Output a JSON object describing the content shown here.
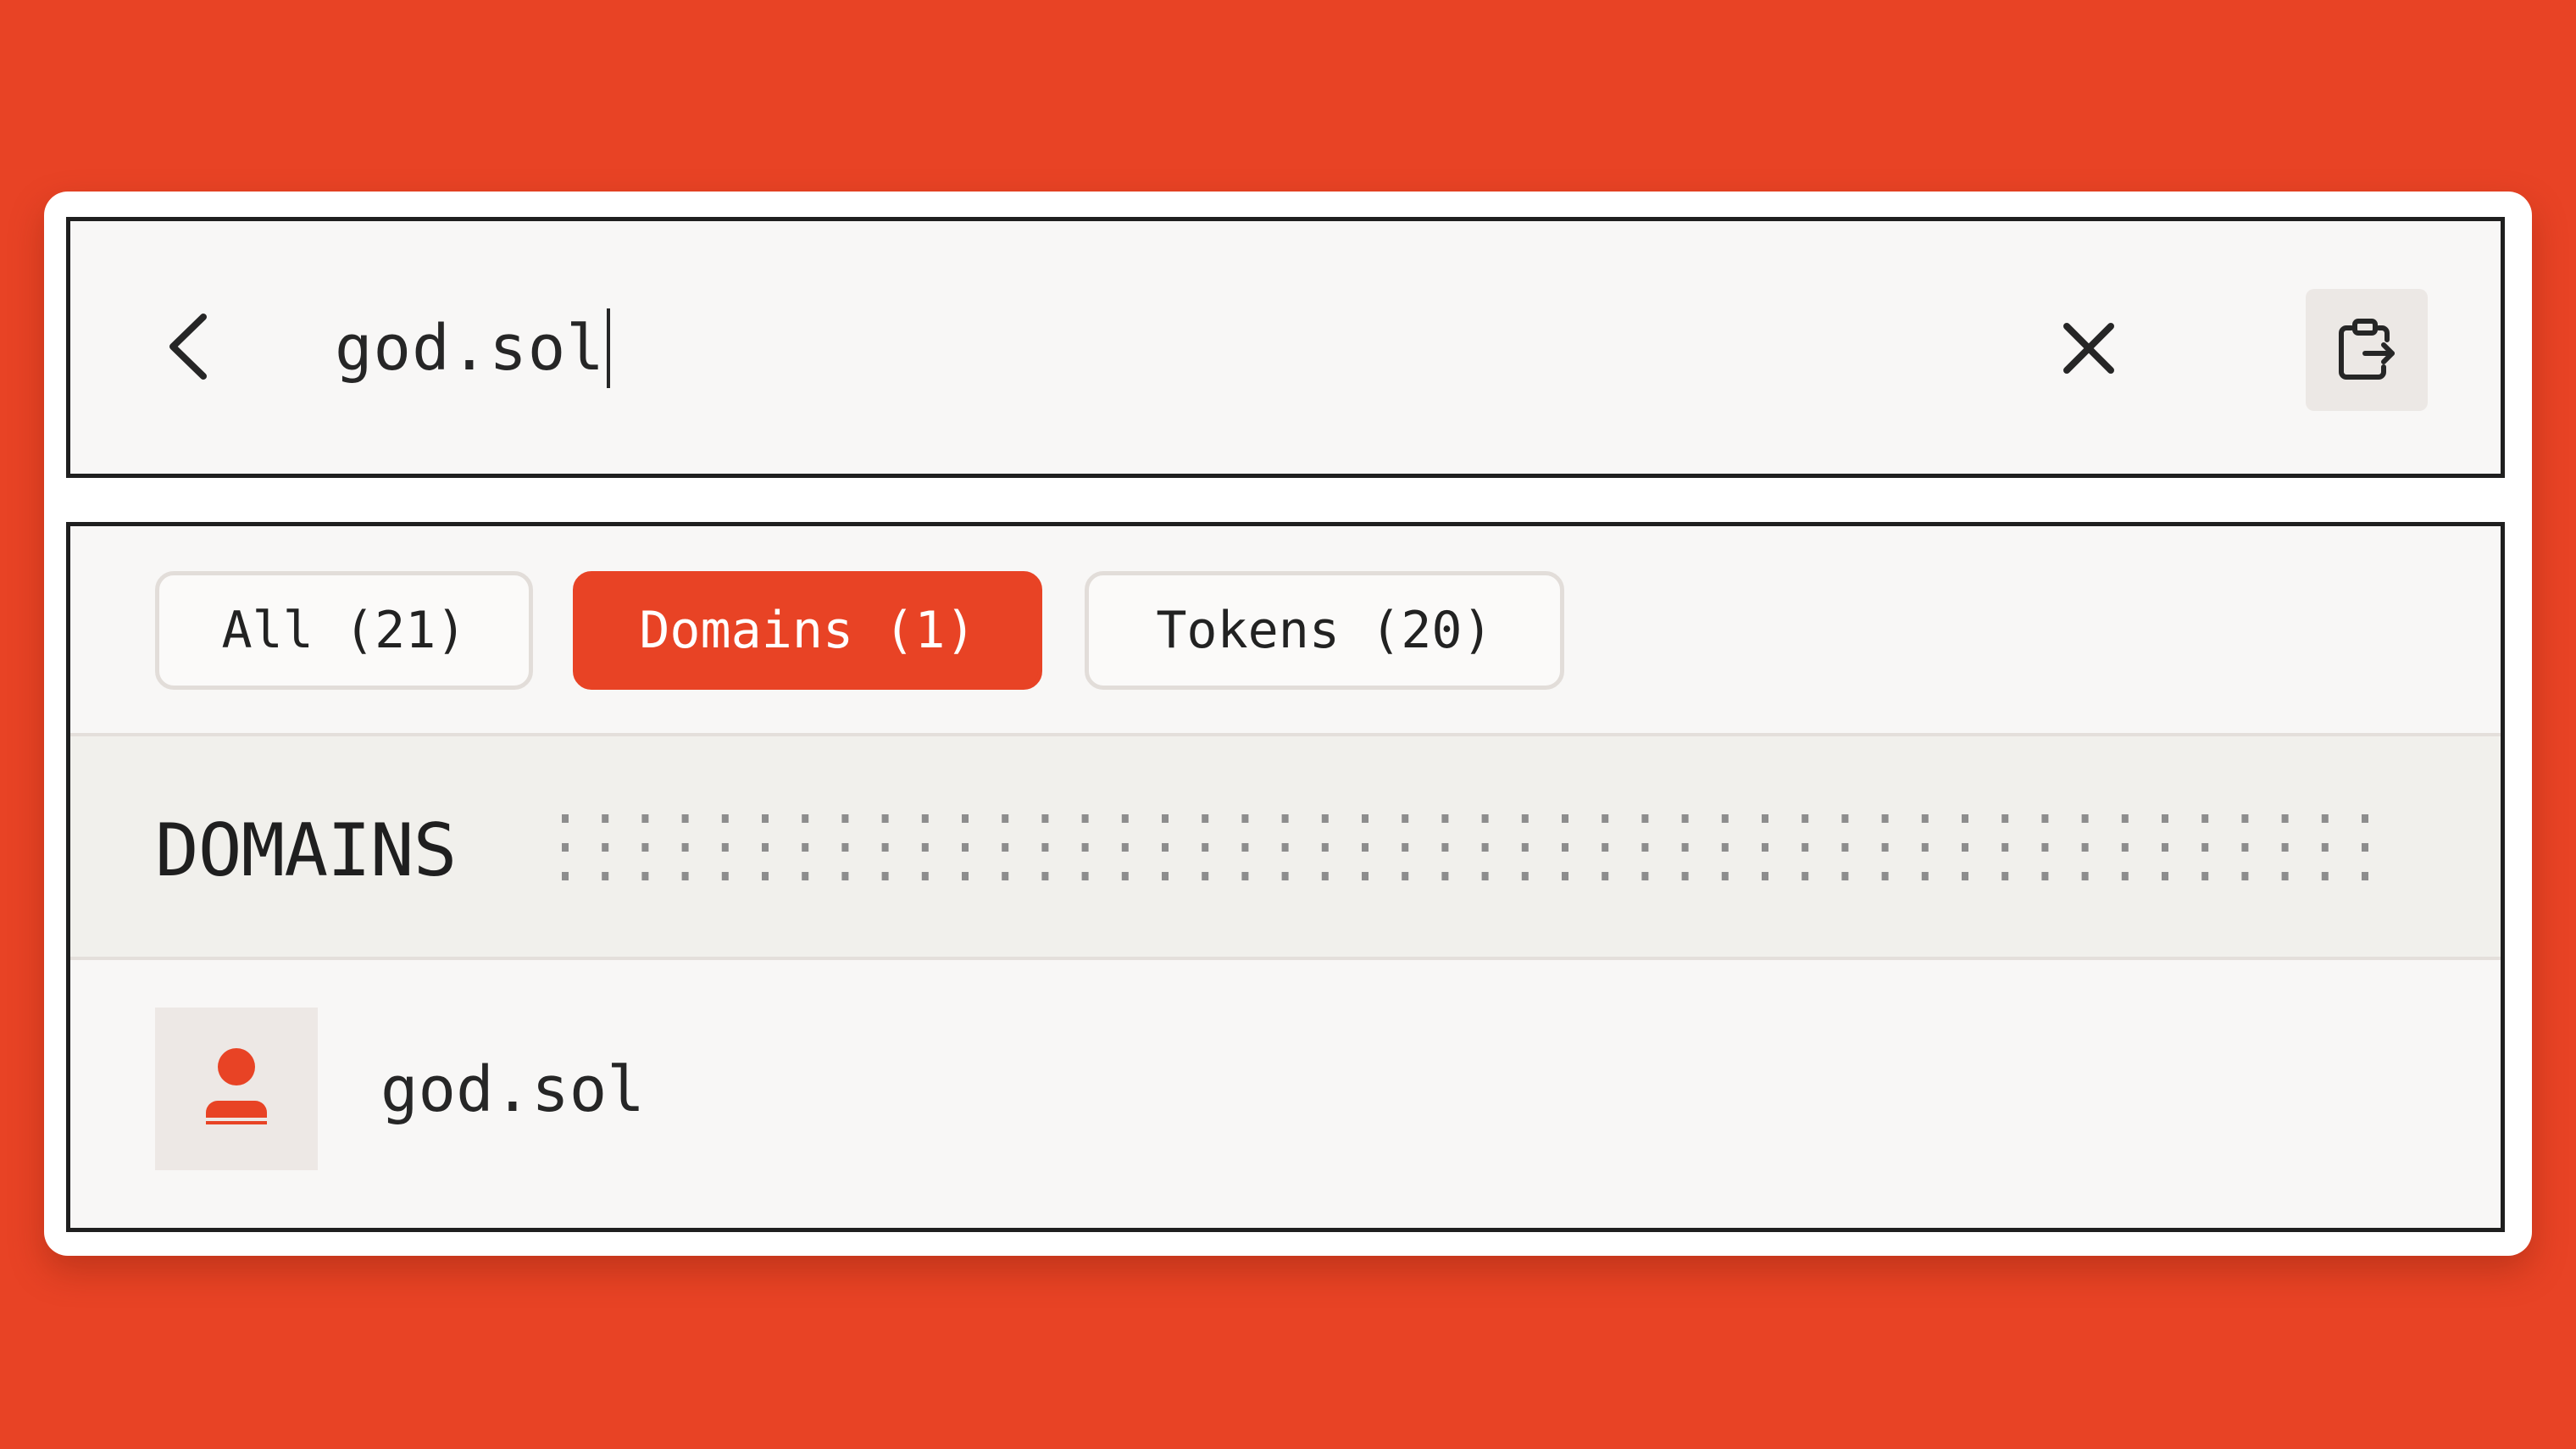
{
  "colors": {
    "background": "#e84325",
    "accent": "#e84325",
    "panel_border": "#1f1f1f",
    "panel_bg": "#f8f7f6",
    "section_bg": "#f1f0ec"
  },
  "search": {
    "value": "god.sol",
    "back_icon": "chevron-left-icon",
    "clear_icon": "close-icon",
    "paste_icon": "clipboard-paste-icon"
  },
  "filters": [
    {
      "label": "All (21)",
      "active": false
    },
    {
      "label": "Domains (1)",
      "active": true
    },
    {
      "label": "Tokens (20)",
      "active": false
    }
  ],
  "section": {
    "title": "DOMAINS"
  },
  "results": [
    {
      "label": "god.sol",
      "icon": "user-icon"
    }
  ]
}
